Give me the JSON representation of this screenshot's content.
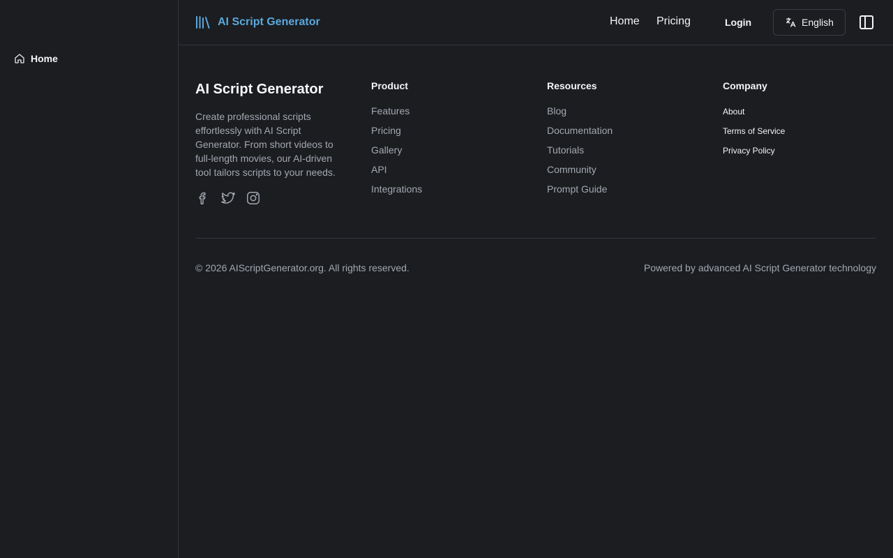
{
  "sidebar": {
    "items": [
      {
        "label": "Home",
        "icon": "home-icon"
      }
    ]
  },
  "header": {
    "brand": {
      "name": "AI Script Generator",
      "icon": "library-icon",
      "color": "#5ba8dd"
    },
    "nav": [
      {
        "label": "Home"
      },
      {
        "label": "Pricing"
      }
    ],
    "login_label": "Login",
    "language": {
      "label": "English",
      "icon": "translate-icon"
    },
    "toggle_icon": "sidebar-toggle-icon"
  },
  "footer": {
    "brand": {
      "title": "AI Script Generator",
      "description": "Create professional scripts effortlessly with AI Script Generator. From short videos to full-length movies, our AI-driven tool tailors scripts to your needs.",
      "socials": [
        "facebook-icon",
        "twitter-icon",
        "instagram-icon"
      ]
    },
    "columns": [
      {
        "heading": "Product",
        "links": [
          "Features",
          "Pricing",
          "Gallery",
          "API",
          "Integrations"
        ]
      },
      {
        "heading": "Resources",
        "links": [
          "Blog",
          "Documentation",
          "Tutorials",
          "Community",
          "Prompt Guide"
        ]
      },
      {
        "heading": "Company",
        "links": [
          "About",
          "Terms of Service",
          "Privacy Policy"
        ]
      }
    ],
    "copyright": "© 2026 AIScriptGenerator.org. All rights reserved.",
    "powered_by": "Powered by advanced AI Script Generator technology"
  },
  "colors": {
    "background": "#1b1d21",
    "border": "#33363c",
    "muted_text": "#a3a8b0",
    "accent": "#5ba8dd"
  }
}
